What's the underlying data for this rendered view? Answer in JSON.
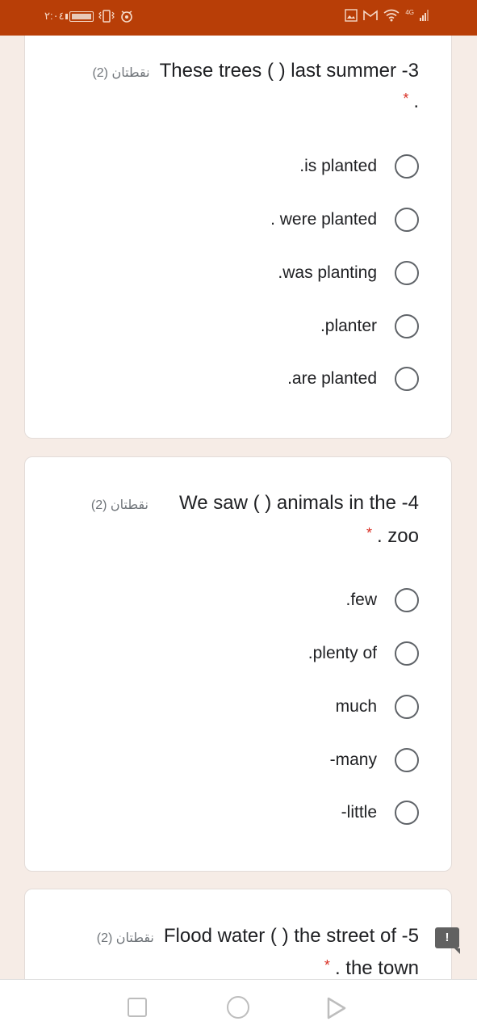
{
  "status_bar": {
    "time": "٢:٠٤",
    "network_label": "4G",
    "colors": {
      "background": "#b83e07",
      "foreground": "#f5d9c8"
    },
    "icons_left": [
      "battery-icon",
      "vibrate-icon",
      "eye-icon"
    ],
    "icons_right": [
      "gallery-icon",
      "gmail-icon",
      "wifi-icon",
      "signal-icon"
    ]
  },
  "questions": [
    {
      "number": "3",
      "line1": "These trees ( ) last summer -3",
      "line2": ".",
      "required_mark": "*",
      "points": "نقطتان (2)",
      "options": [
        ".is planted",
        ". were planted",
        ".was planting",
        ".planter",
        ".are planted"
      ]
    },
    {
      "number": "4",
      "line1": "We saw ( ) animals in the -4",
      "line2": ". zoo",
      "required_mark": "*",
      "points": "نقطتان (2)",
      "options": [
        ".few",
        ".plenty of",
        "much",
        "-many",
        "-little"
      ]
    },
    {
      "number": "5",
      "line1": "Flood water ( ) the street of -5",
      "line2": ". the town",
      "required_mark": "*",
      "points": "نقطتان (2)",
      "options": []
    }
  ],
  "feedback_flag": {
    "label": "!"
  },
  "nav_bar": {
    "buttons": [
      "recents",
      "home",
      "back"
    ]
  },
  "colors": {
    "page_background": "#f6ece6",
    "required": "#d93025",
    "text": "#202124",
    "muted": "#70757a"
  }
}
